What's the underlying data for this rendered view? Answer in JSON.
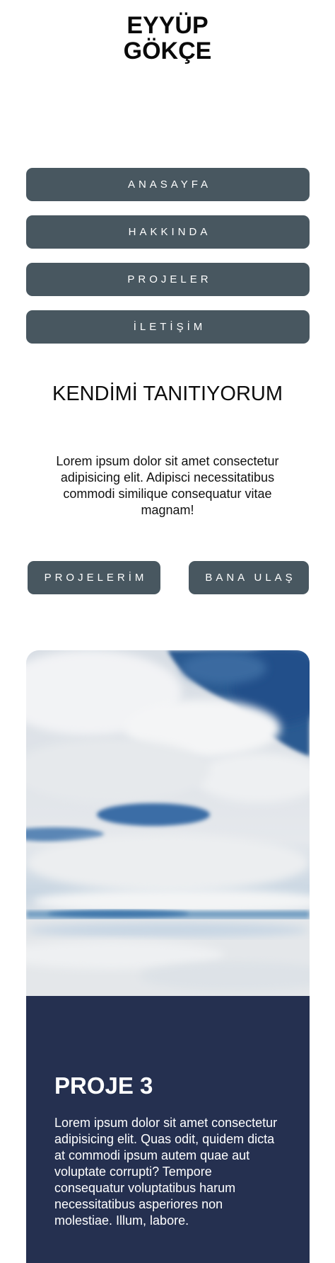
{
  "header": {
    "logo_line1": "EYYÜP",
    "logo_line2": "GÖKÇE"
  },
  "nav": {
    "items": [
      {
        "label": "ANASAYFA"
      },
      {
        "label": "HAKKINDA"
      },
      {
        "label": "PROJELER"
      },
      {
        "label": "İLETİŞİM"
      }
    ]
  },
  "intro": {
    "title": "KENDİMİ TANITIYORUM",
    "text": "Lorem ipsum dolor sit amet consectetur adipisicing elit. Adipisci necessitatibus commodi similique consequatur vitae magnam!"
  },
  "buttons": {
    "projects_label": "PROJELERİM",
    "contact_label": "BANA ULAŞ"
  },
  "project_card": {
    "image_icon": "sky-clouds-landscape-image",
    "title": "PROJE 3",
    "text": "Lorem ipsum dolor sit amet consectetur adipisicing elit. Quas odit, quidem dicta at commodi ipsum autem quae aut voluptate corrupti? Tempore consequatur voluptatibus harum necessitatibus asperiores non molestiae. Illum, labore."
  },
  "colors": {
    "button_bg": "#485760",
    "card_body_bg": "#253050",
    "sky_blue": "#2f5a91"
  }
}
